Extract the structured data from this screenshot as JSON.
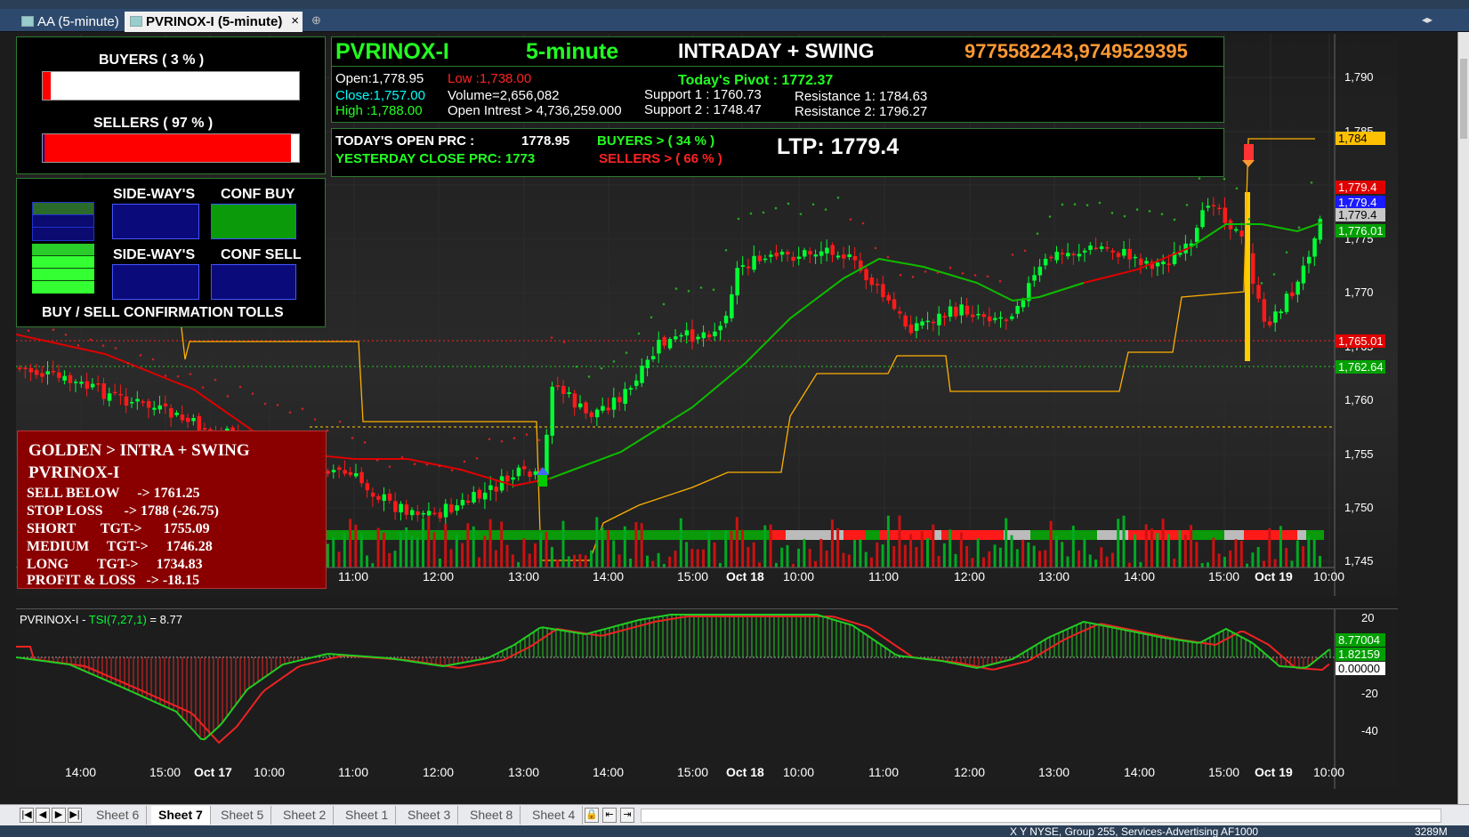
{
  "window": {
    "tabs": [
      {
        "label": "AA (5-minute)",
        "active": false
      },
      {
        "label": "PVRINOX-I (5-minute)",
        "active": true
      }
    ],
    "symbol_box": "PVRINOX-I",
    "interval_box": "5m",
    "close_glyph": "×"
  },
  "header": {
    "symbol": "PVRINOX-I",
    "interval": "5-minute",
    "mode": "INTRADAY + SWING",
    "phones": "9775582243,9749529395",
    "open": "Open:1,778.95",
    "low": "Low :1,738.00",
    "close": "Close:1,757.00",
    "volume": "Volume=2,656,082",
    "high": "High  :1,788.00",
    "oi": "Open Intrest > 4,736,259.000",
    "pivot": "Today's Pivot :  1772.37",
    "support1": "Support 1 : 1760.73",
    "support2": "Support 2 : 1748.47",
    "resistance1": "Resistance 1: 1784.63",
    "resistance2": "Resistance 2: 1796.27"
  },
  "prices": {
    "today_open_label": "TODAY'S OPEN PRC :",
    "today_open_value": "1778.95",
    "yesterday_close": "YESTERDAY CLOSE PRC: 1773",
    "buyers": "BUYERS > ( 34 % )",
    "sellers": "SELLERS > ( 66 % )",
    "ltp": "LTP: 1779.4"
  },
  "pressure": {
    "buyers_label": "BUYERS ( 3 % )",
    "buyers_pct": 3,
    "sellers_label": "SELLERS ( 97 % )",
    "sellers_pct": 97
  },
  "confirm": {
    "sideways1": "SIDE-WAY'S",
    "confbuy": "CONF BUY",
    "sideways2": "SIDE-WAY'S",
    "confsell": "CONF SELL",
    "footer": "BUY / SELL CONFIRMATION TOLLS"
  },
  "golden": {
    "title": "GOLDEN > INTRA + SWING",
    "symbol": "PVRINOX-I",
    "sell_below": "SELL BELOW     -> 1761.25",
    "stop_loss": "STOP LOSS      -> 1788 (-26.75)",
    "short": "SHORT       TGT->      1755.09",
    "medium": "MEDIUM     TGT->     1746.28",
    "long": "LONG        TGT->     1734.83",
    "pnl": "PROFIT & LOSS   -> -18.15"
  },
  "main_axis": {
    "ticks": [
      "1,790",
      "1,785",
      "1,780",
      "1,775",
      "1,770",
      "1,765",
      "1,760",
      "1,755",
      "1,750",
      "1,745"
    ],
    "tags": [
      {
        "text": "1,784",
        "bg": "#ffc000",
        "fg": "#000"
      },
      {
        "text": "1,779.4",
        "bg": "#e00000",
        "fg": "#fff"
      },
      {
        "text": "1,779.4",
        "bg": "#1a1aff",
        "fg": "#fff"
      },
      {
        "text": "1,779.4",
        "bg": "#c8c8c8",
        "fg": "#000"
      },
      {
        "text": "1,776.01",
        "bg": "#00a000",
        "fg": "#fff"
      },
      {
        "text": "1,765.01",
        "bg": "#e00000",
        "fg": "#fff"
      },
      {
        "text": "1,762.64",
        "bg": "#00a000",
        "fg": "#fff"
      }
    ]
  },
  "time_axis": [
    "14:00",
    "15:00",
    "Oct 17",
    "10:00",
    "11:00",
    "12:00",
    "13:00",
    "14:00",
    "15:00",
    "Oct 18",
    "10:00",
    "11:00",
    "12:00",
    "13:00",
    "14:00",
    "15:00",
    "Oct 19",
    "10:00"
  ],
  "indicator": {
    "title_prefix": "PVRINOX-I - ",
    "title_fn": "TSI(7,27,1)",
    "title_value": " = 8.77",
    "ticks": [
      "20",
      "-20",
      "-40"
    ],
    "tags": [
      {
        "text": "8.77004",
        "bg": "#00a000",
        "fg": "#fff"
      },
      {
        "text": "1.82159",
        "bg": "#00a000",
        "fg": "#fff"
      },
      {
        "text": "0.00000",
        "bg": "#ffffff",
        "fg": "#000"
      }
    ]
  },
  "sheets": [
    "Sheet 6",
    "Sheet 7",
    "Sheet 5",
    "Sheet 2",
    "Sheet 1",
    "Sheet 3",
    "Sheet 8",
    "Sheet 4"
  ],
  "active_sheet": "Sheet 7",
  "nav_buttons": [
    "|◀",
    "◀",
    "▶",
    "▶|"
  ],
  "status": "X   Y   NYSE, Group 255, Services-Advertising   AF1000",
  "status_right": "3289M",
  "colors": {
    "bull": "#00ff33",
    "bear": "#ff1a1a",
    "ema_green": "#00c000",
    "ema_red": "#e00000",
    "band": "#ffb000"
  },
  "icons": [
    "disk-icon",
    "tab-chart-icon",
    "close-icon",
    "new-tab-icon",
    "sell-arrow-icon",
    "buy-arrow-icon",
    "scroll-left-icon",
    "scroll-right-icon",
    "lock-icon"
  ]
}
